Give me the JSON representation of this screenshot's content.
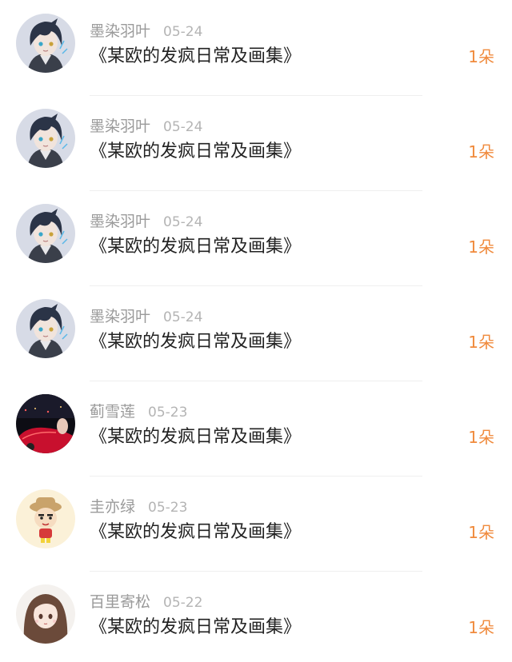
{
  "items": [
    {
      "name": "墨染羽叶",
      "date": "05-24",
      "title": "《某欧的发疯日常及画集》",
      "count": "1朵",
      "avatar": "anime-avatar-blue-hair-icon"
    },
    {
      "name": "墨染羽叶",
      "date": "05-24",
      "title": "《某欧的发疯日常及画集》",
      "count": "1朵",
      "avatar": "anime-avatar-blue-hair-icon"
    },
    {
      "name": "墨染羽叶",
      "date": "05-24",
      "title": "《某欧的发疯日常及画集》",
      "count": "1朵",
      "avatar": "anime-avatar-blue-hair-icon"
    },
    {
      "name": "墨染羽叶",
      "date": "05-24",
      "title": "《某欧的发疯日常及画集》",
      "count": "1朵",
      "avatar": "anime-avatar-blue-hair-icon"
    },
    {
      "name": "蓟雪莲",
      "date": "05-23",
      "title": "《某欧的发疯日常及画集》",
      "count": "1朵",
      "avatar": "red-car-night-photo-icon"
    },
    {
      "name": "圭亦绿",
      "date": "05-23",
      "title": "《某欧的发疯日常及画集》",
      "count": "1朵",
      "avatar": "cartoon-boy-hat-icon"
    },
    {
      "name": "百里寄松",
      "date": "05-22",
      "title": "《某欧的发疯日常及画集》",
      "count": "1朵",
      "avatar": "anime-girl-brown-hair-icon"
    }
  ],
  "colors": {
    "count": "#f08a3c",
    "name": "#9a9a9a",
    "title": "#222222"
  }
}
